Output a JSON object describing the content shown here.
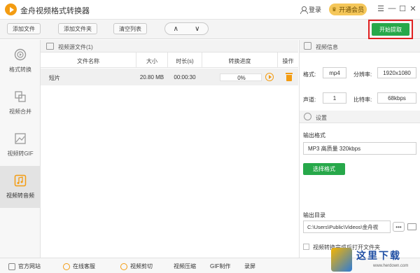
{
  "titlebar": {
    "app_title": "金舟视频格式转换器",
    "login_label": "登录",
    "vip_label": "开通会员",
    "menu_symbol": "☰",
    "minimize_symbol": "—",
    "maximize_symbol": "☐",
    "close_symbol": "✕"
  },
  "toolbar": {
    "add_file": "添加文件",
    "add_folder": "添加文件夹",
    "clear_list": "清空列表",
    "up_arrow": "∧",
    "down_arrow": "∨",
    "start": "开始提取"
  },
  "sidebar": {
    "items": [
      {
        "label": "格式转换",
        "icon": "play-circle-icon"
      },
      {
        "label": "视频合并",
        "icon": "merge-icon"
      },
      {
        "label": "视频转GIF",
        "icon": "image-icon"
      },
      {
        "label": "视频转音频",
        "icon": "music-note-icon",
        "active": true
      }
    ]
  },
  "file_panel": {
    "header": "视频源文件(1)",
    "columns": [
      "文件名称",
      "大小",
      "时长(s)",
      "转换进度",
      "操作"
    ],
    "rows": [
      {
        "name": "短片",
        "size": "20.80 MB",
        "duration": "00:00:30",
        "progress_text": "0%",
        "progress": 0
      }
    ]
  },
  "video_info": {
    "header": "视频信息",
    "format_label": "格式:",
    "format_value": "mp4",
    "resolution_label": "分辨率:",
    "resolution_value": "1920x1080",
    "channel_label": "声道:",
    "channel_value": "1",
    "bitrate_label": "比特率:",
    "bitrate_value": "68kbps"
  },
  "settings": {
    "header": "设置",
    "output_format_label": "输出格式",
    "output_format_value": "MP3 高质量 320kbps",
    "choose_format": "选择格式",
    "output_dir_label": "输出目录",
    "output_dir_value": "C:\\Users\\Public\\Videos\\金舟视",
    "more_symbol": "•••",
    "checkbox_label": "视频转换完成后打开文件夹"
  },
  "bottombar": {
    "items": [
      "官方网站",
      "在线客服",
      "视频剪切",
      "视频压缩",
      "GIF制作",
      "录屏"
    ]
  },
  "watermark": {
    "text": "这里下载",
    "url": "www.herdown.com"
  },
  "colors": {
    "accent_green": "#27a84a",
    "highlight_red": "#e02020",
    "icon_orange": "#f39c12",
    "vip_gold": "#f5c75a"
  }
}
